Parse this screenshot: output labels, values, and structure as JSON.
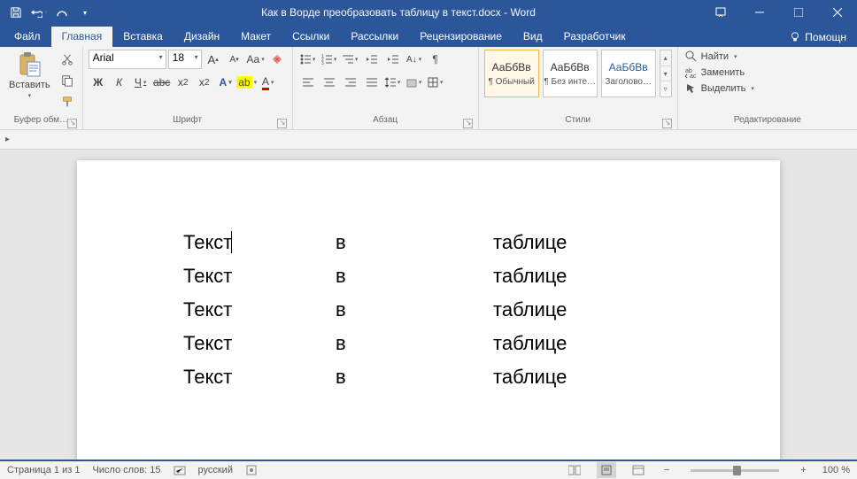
{
  "window": {
    "title": "Как в Ворде преобразовать таблицу в текст.docx - Word"
  },
  "tabs": {
    "file": "Файл",
    "home": "Главная",
    "insert": "Вставка",
    "design": "Дизайн",
    "layout": "Макет",
    "references": "Ссылки",
    "mailings": "Рассылки",
    "review": "Рецензирование",
    "view": "Вид",
    "developer": "Разработчик",
    "help": "Помощн"
  },
  "ribbon": {
    "clipboard": {
      "label": "Буфер обм…",
      "paste": "Вставить"
    },
    "font": {
      "label": "Шрифт",
      "name": "Arial",
      "size": "18",
      "bold": "Ж",
      "italic": "К",
      "underline": "Ч"
    },
    "paragraph": {
      "label": "Абзац"
    },
    "styles": {
      "label": "Стили",
      "sample": "АаБбВв",
      "normal": "¶ Обычный",
      "nospace": "¶ Без инте…",
      "heading1": "Заголово…"
    },
    "editing": {
      "label": "Редактирование",
      "find": "Найти",
      "replace": "Заменить",
      "select": "Выделить"
    }
  },
  "document": {
    "rows": [
      {
        "c1": "Текст",
        "c2": "в",
        "c3": "таблице"
      },
      {
        "c1": "Текст",
        "c2": "в",
        "c3": "таблице"
      },
      {
        "c1": "Текст",
        "c2": "в",
        "c3": "таблице"
      },
      {
        "c1": "Текст",
        "c2": "в",
        "c3": "таблице"
      },
      {
        "c1": "Текст",
        "c2": "в",
        "c3": "таблице"
      }
    ]
  },
  "status": {
    "page": "Страница 1 из 1",
    "words": "Число слов: 15",
    "language": "русский",
    "zoom": "100 %"
  }
}
